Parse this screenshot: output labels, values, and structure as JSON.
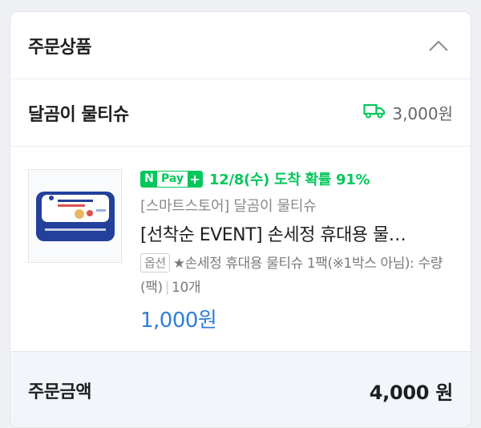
{
  "section": {
    "title": "주문상품"
  },
  "store": {
    "name": "달곰이 물티슈",
    "shipping_fee": "3,000원",
    "shipping_icon": "truck-icon"
  },
  "item": {
    "npay_n": "N",
    "npay_pay": "Pay",
    "npay_plus": "+",
    "arrival": "12/8(수) 도착 확률 91%",
    "seller": "[스마트스토어] 달곰이 물티슈",
    "title": "[선착순 EVENT] 손세정 휴대용 물…",
    "option_tag": "옵션",
    "option_text": "★손세정 휴대용 물티슈 1팩(※1박스 아님): 수량(팩)",
    "quantity": "10개",
    "price": "1,000원"
  },
  "total": {
    "label": "주문금액",
    "value": "4,000 원"
  },
  "colors": {
    "accent_green": "#03c75a",
    "price_blue": "#2f7fd6",
    "total_bg": "#f2f6fb"
  }
}
